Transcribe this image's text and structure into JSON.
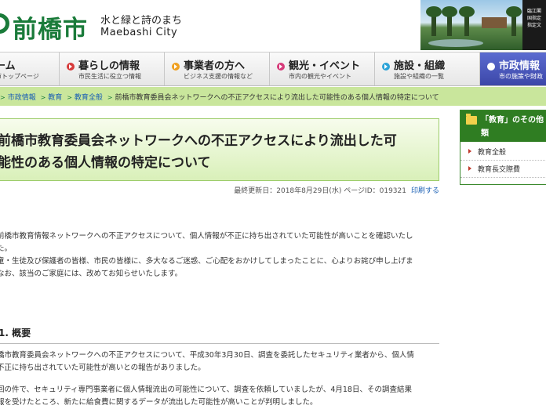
{
  "header": {
    "logo_name": "前橋市",
    "tagline_jp": "水と緑と詩のまち",
    "tagline_en": "Maebashi City",
    "photo_caption_lines": [
      "臨江閣",
      "国指定",
      "指定文"
    ]
  },
  "nav": [
    {
      "title": "ーム",
      "sub": "市トップページ",
      "color": "#d0d0d0"
    },
    {
      "title": "暮らしの情報",
      "sub": "市民生活に役立つ情報",
      "color": "#d63b3b"
    },
    {
      "title": "事業者の方へ",
      "sub": "ビジネス支援の情報など",
      "color": "#f0a020"
    },
    {
      "title": "観光・イベント",
      "sub": "市内の観光やイベント",
      "color": "#d63b7a"
    },
    {
      "title": "施設・組織",
      "sub": "施設や組織の一覧",
      "color": "#2ba3d8"
    },
    {
      "title": "市政情報",
      "sub": "市の施策や財政",
      "color": "#3c47a8"
    }
  ],
  "breadcrumb": {
    "links": [
      "市政情報",
      "教育",
      "教育全般"
    ],
    "current": "前橋市教育委員会ネットワークへの不正アクセスにより流出した可能性のある個人情報の特定について"
  },
  "article": {
    "title_line1": "前橋市教育委員会ネットワークへの不正アクセスにより流出した可",
    "title_line2": "能性のある個人情報の特定について",
    "meta": "最終更新日：2018年8月29日(水) ページID：019321",
    "print_label": "印刷する",
    "intro_lines": [
      "前橋市教育情報ネットワークへの不正アクセスについて、個人情報が不正に持ち出されていた可能性が高いことを確認いたし",
      "た。",
      "童・生徒及び保護者の皆様、市民の皆様に、多大なるご迷惑、ご心配をおかけしてしまったことに、心よりお詫び申し上げま",
      "なお、該当のご家庭には、改めてお知らせいたします。"
    ],
    "section_heading": "1. 概要",
    "section_p1": [
      "橋市教育委員会ネットワークへの不正アクセスについて、平成30年3月30日、調査を委託したセキュリティ業者から、個人情",
      "不正に持ち出されていた可能性が高いとの報告がありました。"
    ],
    "section_p2": [
      "回の件で、セキュリティ専門事業者に個人情報流出の可能性について、調査を依頼していましたが、4月18日、その調査結果",
      "報を受けたところ、新たに給食費に関するデータが流出した可能性が高いことが判明しました。"
    ]
  },
  "sidebar": {
    "heading_line1": "「教育」のその他",
    "heading_line2": "類",
    "items": [
      "教育全般",
      "教育長交際費"
    ]
  }
}
